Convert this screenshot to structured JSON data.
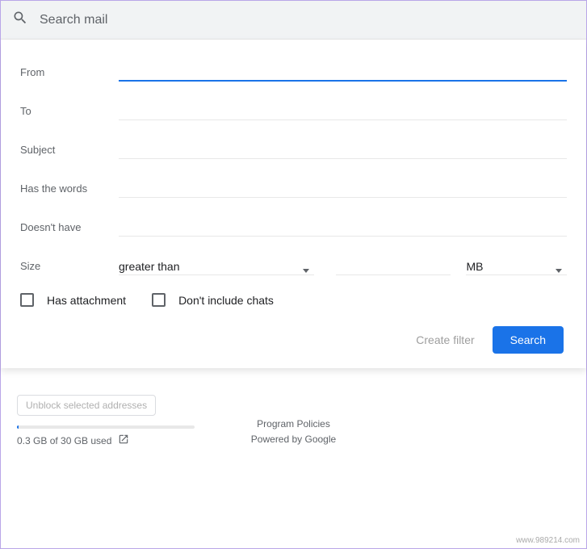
{
  "search": {
    "placeholder": "Search mail"
  },
  "form": {
    "from_label": "From",
    "to_label": "To",
    "subject_label": "Subject",
    "has_words_label": "Has the words",
    "doesnt_have_label": "Doesn't have",
    "size_label": "Size",
    "size_comparator": "greater than",
    "size_unit": "MB",
    "has_attachment_label": "Has attachment",
    "dont_include_chats_label": "Don't include chats",
    "create_filter_label": "Create filter",
    "search_button_label": "Search"
  },
  "background": {
    "unblock_label": "Unblock selected addresses"
  },
  "footer": {
    "storage_text": "0.3 GB of 30 GB used",
    "policies_label": "Program Policies",
    "powered_label": "Powered by Google"
  },
  "watermark": "www.989214.com"
}
